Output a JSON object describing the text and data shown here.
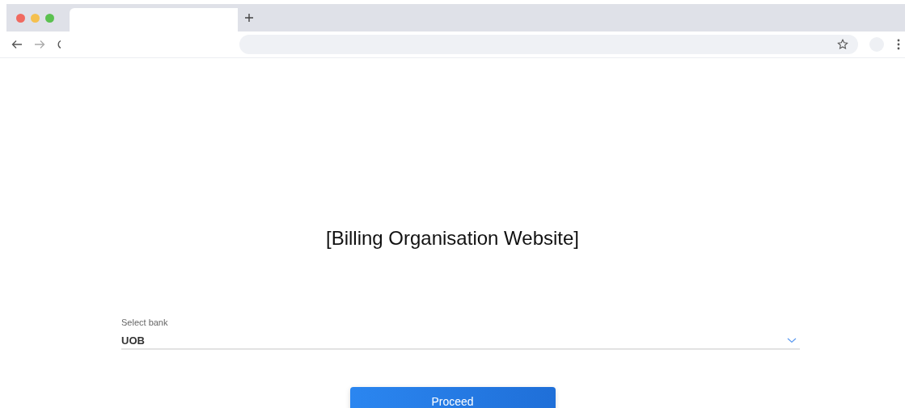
{
  "page": {
    "heading": "[Billing Organisation Website]"
  },
  "bank_select": {
    "label": "Select bank",
    "value": "UOB"
  },
  "proceed_button": {
    "label": "Proceed"
  }
}
